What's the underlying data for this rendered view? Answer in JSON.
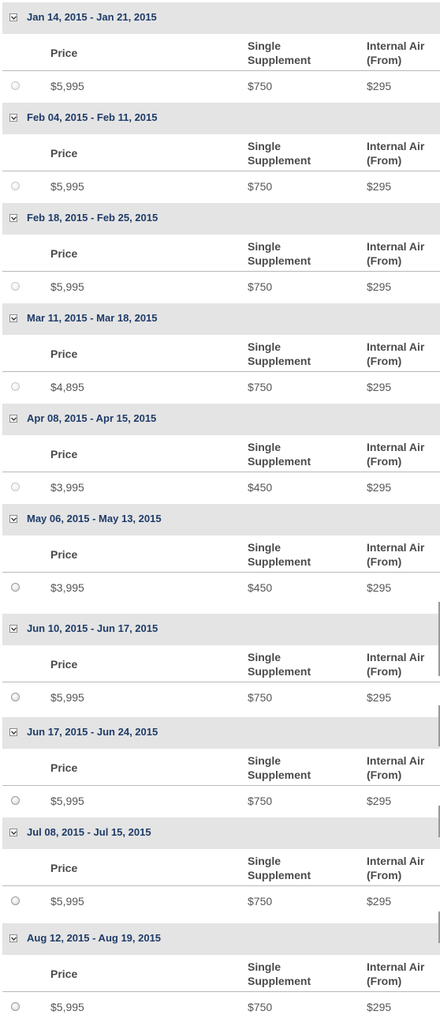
{
  "columns": {
    "price": "Price",
    "single_supplement_line1": "Single",
    "single_supplement_line2": "Supplement",
    "internal_air_line1": "Internal Air",
    "internal_air_line2": "(From)"
  },
  "departures": [
    {
      "dates": "Jan 14, 2015 - Jan 21, 2015",
      "price": "$5,995",
      "single_supplement": "$750",
      "internal_air": "$295"
    },
    {
      "dates": "Feb 04, 2015 - Feb 11, 2015",
      "price": "$5,995",
      "single_supplement": "$750",
      "internal_air": "$295"
    },
    {
      "dates": "Feb 18, 2015 - Feb 25, 2015",
      "price": "$5,995",
      "single_supplement": "$750",
      "internal_air": "$295"
    },
    {
      "dates": "Mar 11, 2015 - Mar 18, 2015",
      "price": "$4,895",
      "single_supplement": "$750",
      "internal_air": "$295"
    },
    {
      "dates": "Apr 08, 2015 - Apr 15, 2015",
      "price": "$3,995",
      "single_supplement": "$450",
      "internal_air": "$295"
    },
    {
      "dates": "May 06, 2015 - May 13, 2015",
      "price": "$3,995",
      "single_supplement": "$450",
      "internal_air": "$295"
    },
    {
      "dates": "Jun 10, 2015 - Jun 17, 2015",
      "price": "$5,995",
      "single_supplement": "$750",
      "internal_air": "$295"
    },
    {
      "dates": "Jun 17, 2015 - Jun 24, 2015",
      "price": "$5,995",
      "single_supplement": "$750",
      "internal_air": "$295"
    },
    {
      "dates": "Jul 08, 2015 - Jul 15, 2015",
      "price": "$5,995",
      "single_supplement": "$750",
      "internal_air": "$295"
    },
    {
      "dates": "Aug 12, 2015 - Aug 19, 2015",
      "price": "$5,995",
      "single_supplement": "$750",
      "internal_air": "$295"
    }
  ],
  "icons": {
    "toggle": "collapse-toggle-icon",
    "radio": "radio-button"
  },
  "colors": {
    "date_text": "#1e3b68",
    "date_bar": "#e4e4e4",
    "body_text": "#555555"
  }
}
